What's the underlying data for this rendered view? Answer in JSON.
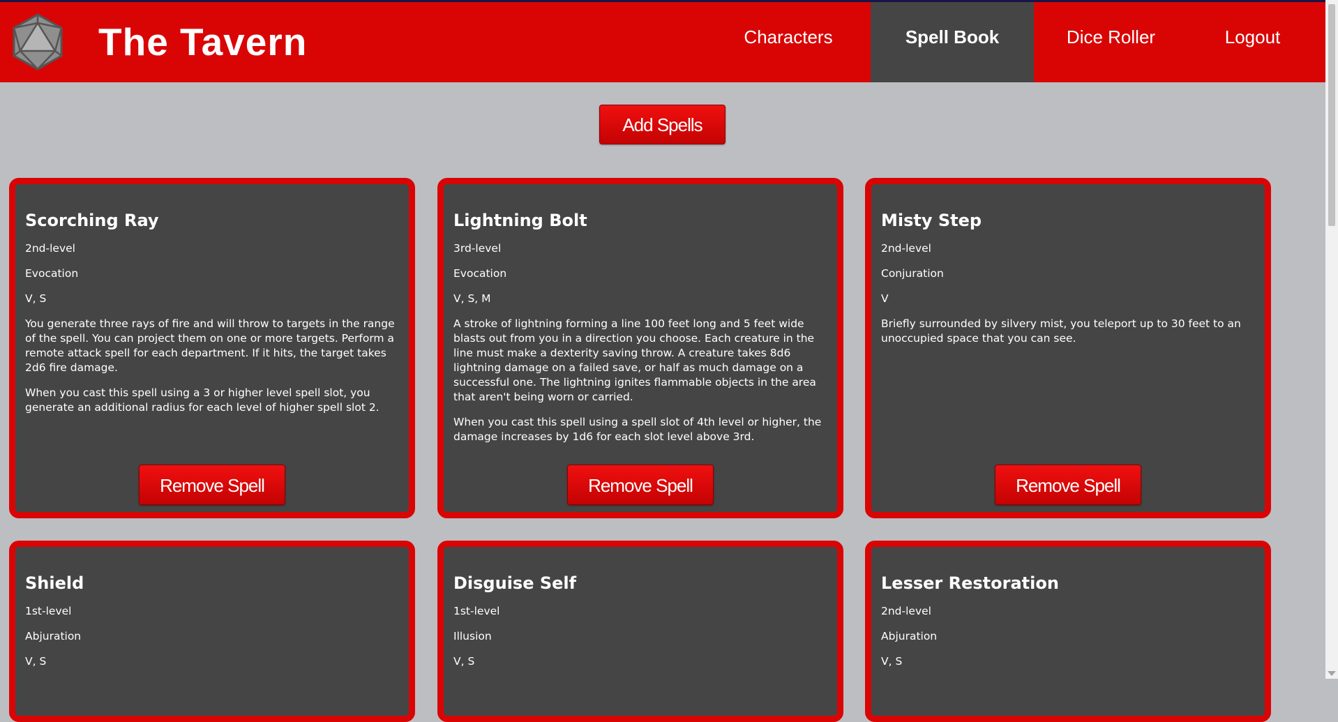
{
  "header": {
    "brand": "The Tavern",
    "logo_icon": "d20-die-icon",
    "colors": {
      "bar": "#d90505",
      "active_tab": "#454545"
    },
    "nav": [
      {
        "label": "Characters",
        "active": false
      },
      {
        "label": "Spell Book",
        "active": true
      },
      {
        "label": "Dice Roller",
        "active": false
      },
      {
        "label": "Logout",
        "active": false
      }
    ]
  },
  "main": {
    "add_button": "Add Spells",
    "spells": [
      {
        "name": "Scorching Ray",
        "level": "2nd-level",
        "school": "Evocation",
        "components": "V, S",
        "description": "You generate three rays of fire and will throw to targets in the range of the spell. You can project them on one or more targets. Perform a remote attack spell for each department. If it hits, the target takes 2d6 fire damage.",
        "higher_levels": "When you cast this spell using a 3 or higher level spell slot, you generate an additional radius for each level of higher spell slot 2.",
        "remove_label": "Remove Spell"
      },
      {
        "name": "Lightning Bolt",
        "level": "3rd-level",
        "school": "Evocation",
        "components": "V, S, M",
        "description": "A stroke of lightning forming a line 100 feet long and 5 feet wide blasts out from you in a direction you choose. Each creature in the line must make a dexterity saving throw. A creature takes 8d6 lightning damage on a failed save, or half as much damage on a successful one. The lightning ignites flammable objects in the area that aren't being worn or carried.",
        "higher_levels": "When you cast this spell using a spell slot of 4th level or higher, the damage increases by 1d6 for each slot level above 3rd.",
        "remove_label": "Remove Spell"
      },
      {
        "name": "Misty Step",
        "level": "2nd-level",
        "school": "Conjuration",
        "components": "V",
        "description": "Briefly surrounded by silvery mist, you teleport up to 30 feet to an unoccupied space that you can see.",
        "higher_levels": "",
        "remove_label": "Remove Spell"
      },
      {
        "name": "Shield",
        "level": "1st-level",
        "school": "Abjuration",
        "components": "V, S"
      },
      {
        "name": "Disguise Self",
        "level": "1st-level",
        "school": "Illusion",
        "components": "V, S"
      },
      {
        "name": "Lesser Restoration",
        "level": "2nd-level",
        "school": "Abjuration",
        "components": "V, S"
      }
    ]
  }
}
